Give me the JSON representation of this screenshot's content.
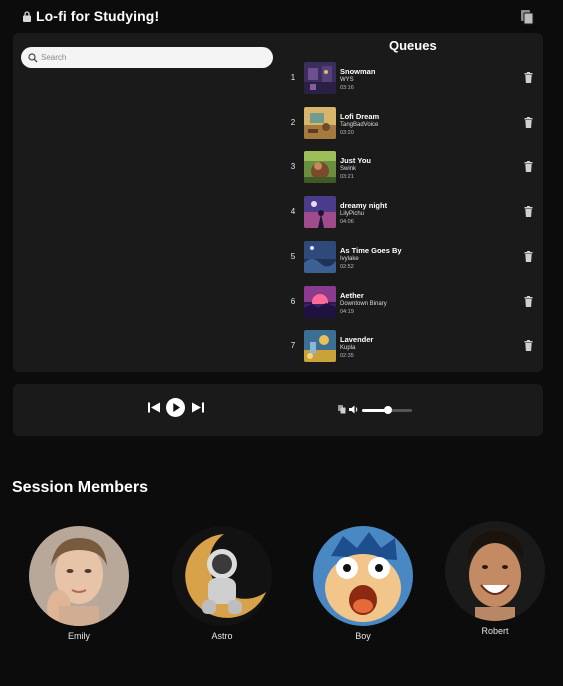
{
  "header": {
    "title": "Lo-fi for Studying!"
  },
  "search": {
    "placeholder": "Search",
    "value": ""
  },
  "queue": {
    "title": "Queues",
    "items": [
      {
        "num": "1",
        "title": "Snowman",
        "artist": "WYS",
        "duration": "03:16"
      },
      {
        "num": "2",
        "title": "Lofi Dream",
        "artist": "TangBadVoice",
        "duration": "03:20"
      },
      {
        "num": "3",
        "title": "Just You",
        "artist": "Swink",
        "duration": "03:21"
      },
      {
        "num": "4",
        "title": "dreamy night",
        "artist": "LilyPichu",
        "duration": "04:06"
      },
      {
        "num": "5",
        "title": "As Time Goes By",
        "artist": "Ivylake",
        "duration": "02:52"
      },
      {
        "num": "6",
        "title": "Aether",
        "artist": "Downtown Binary",
        "duration": "04:19"
      },
      {
        "num": "7",
        "title": "Lavender",
        "artist": "Kupla",
        "duration": "02:35"
      }
    ]
  },
  "player": {
    "volume": 0.52
  },
  "members": {
    "title": "Session Members",
    "list": [
      {
        "name": "Emily"
      },
      {
        "name": "Astro"
      },
      {
        "name": "Boy"
      },
      {
        "name": "Robert"
      }
    ]
  },
  "colors": {
    "background": "#0d0c0d",
    "panel": "#1b1a1b",
    "text": "#ffffff"
  }
}
